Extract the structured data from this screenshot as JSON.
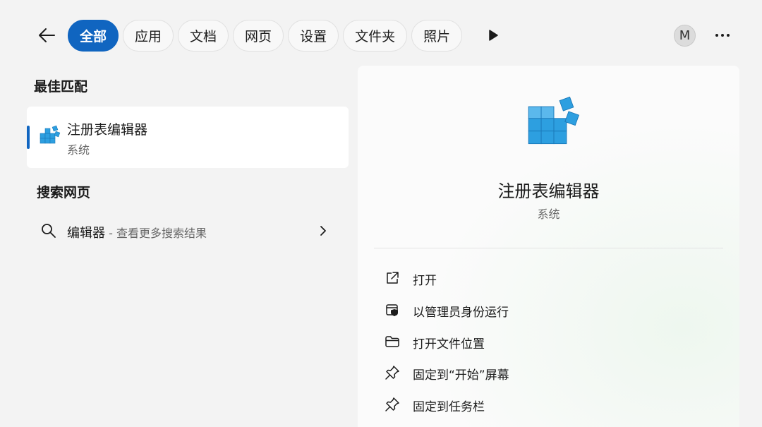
{
  "tabs": [
    {
      "label": "全部",
      "active": true
    },
    {
      "label": "应用"
    },
    {
      "label": "文档"
    },
    {
      "label": "网页"
    },
    {
      "label": "设置"
    },
    {
      "label": "文件夹"
    },
    {
      "label": "照片"
    }
  ],
  "avatar": {
    "initial": "M"
  },
  "best_match": {
    "heading": "最佳匹配",
    "name": "注册表编辑器",
    "type": "系统"
  },
  "web_search": {
    "heading": "搜索网页",
    "query": "编辑器",
    "hint": " - 查看更多搜索结果"
  },
  "preview": {
    "name": "注册表编辑器",
    "type": "系统",
    "actions": [
      {
        "label": "打开",
        "icon": "open-external-icon"
      },
      {
        "label": "以管理员身份运行",
        "icon": "shield-admin-icon"
      },
      {
        "label": "打开文件位置",
        "icon": "folder-icon"
      },
      {
        "label": "固定到“开始”屏幕",
        "icon": "pin-icon"
      },
      {
        "label": "固定到任务栏",
        "icon": "pin-icon"
      }
    ]
  },
  "colors": {
    "accent": "#1065c0",
    "registry_icon": "#2d9fe0"
  }
}
